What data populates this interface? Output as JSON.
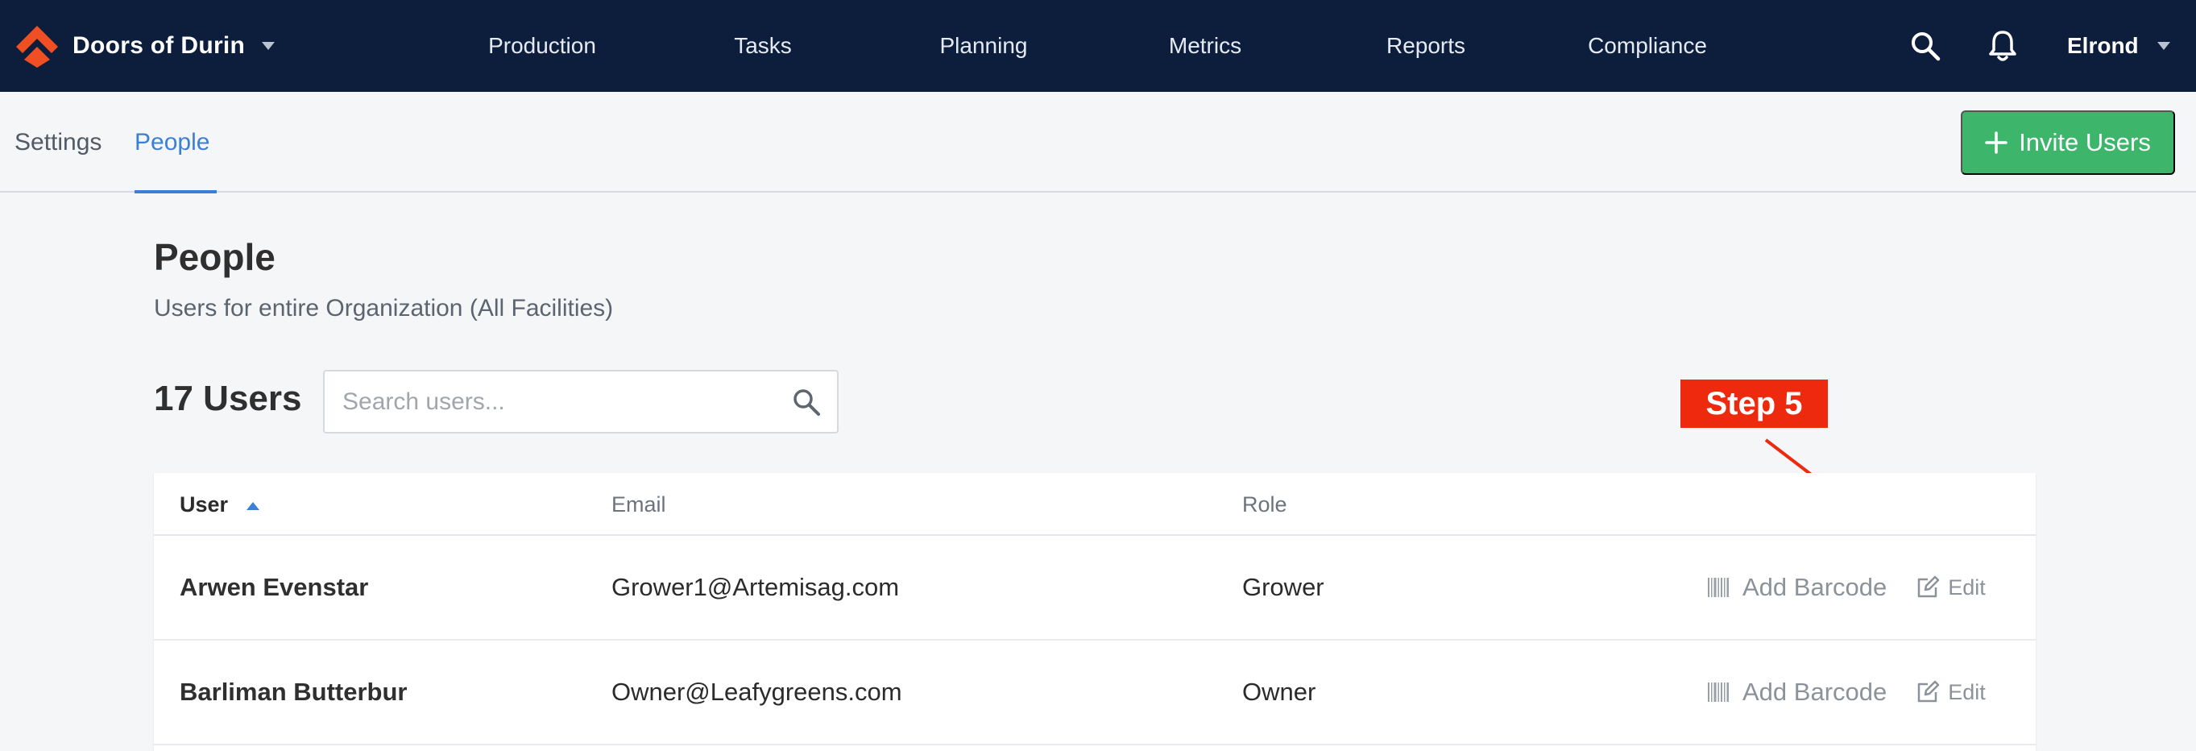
{
  "header": {
    "org_name": "Doors of Durin",
    "nav": [
      {
        "label": "Production"
      },
      {
        "label": "Tasks"
      },
      {
        "label": "Planning"
      },
      {
        "label": "Metrics"
      },
      {
        "label": "Reports"
      },
      {
        "label": "Compliance"
      }
    ],
    "user_name": "Elrond",
    "icons": {
      "logo": "brand-logo-icon",
      "search": "search-icon",
      "notifications": "bell-icon"
    }
  },
  "subnav": {
    "tabs": [
      {
        "label": "Settings",
        "active": false
      },
      {
        "label": "People",
        "active": true
      }
    ],
    "invite_label": "Invite Users"
  },
  "page": {
    "title": "People",
    "subtitle": "Users for entire Organization (All Facilities)",
    "count_label": "17 Users",
    "search_placeholder": "Search users..."
  },
  "annotation": {
    "step_label": "Step 5"
  },
  "table": {
    "columns": [
      "User",
      "Email",
      "Role"
    ],
    "sorted_by": "User",
    "sort_direction": "ascending",
    "rows": [
      {
        "name": "Arwen Evenstar",
        "email": "Grower1@Artemisag.com",
        "role": "Grower",
        "barcode_label": "Add Barcode",
        "edit_label": "Edit"
      },
      {
        "name": "Barliman Butterbur",
        "email": "Owner@Leafygreens.com",
        "role": "Owner",
        "barcode_label": "Add Barcode",
        "edit_label": "Edit"
      }
    ]
  },
  "colors": {
    "nav_bg": "#0c1e3c",
    "accent_blue": "#3d7fd6",
    "invite_green": "#3db66c",
    "annotation_red": "#ee2a0e",
    "logo_orange": "#f04e23"
  }
}
